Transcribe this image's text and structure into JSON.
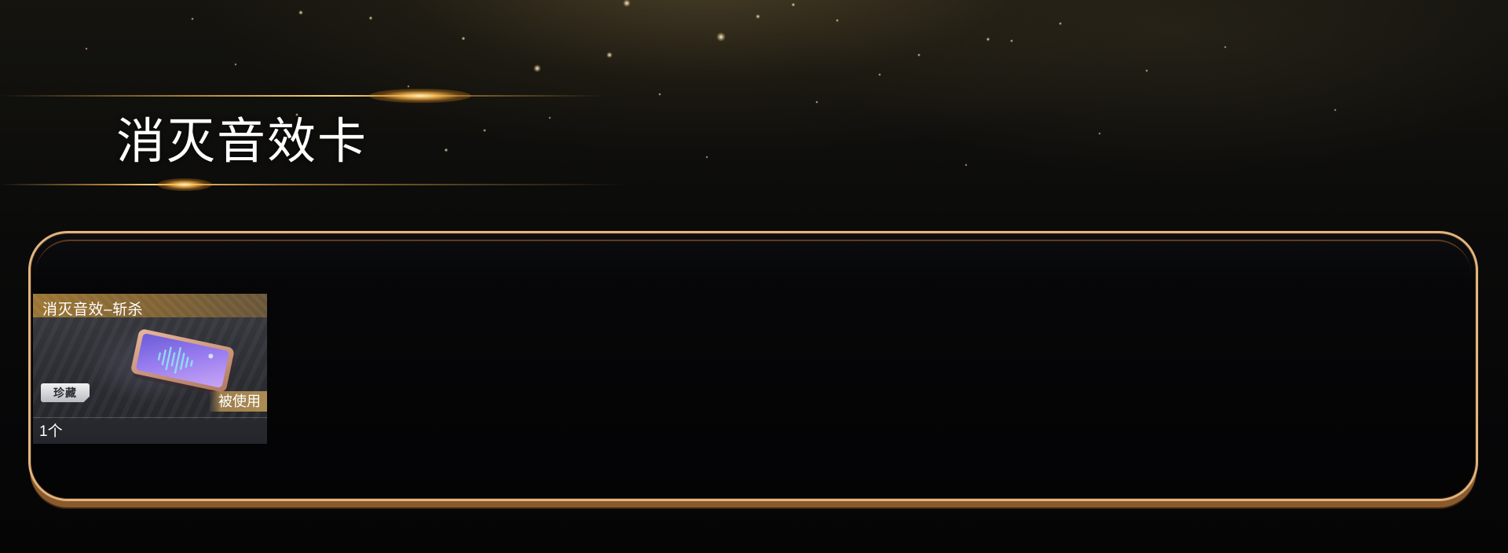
{
  "header": {
    "title": "消灭音效卡"
  },
  "items": [
    {
      "name": "消灭音效–斩杀",
      "rarity": "珍藏",
      "status": "被使用",
      "count": "1个"
    }
  ],
  "colors": {
    "accent_gold": "#e2b47e",
    "panel_shadow": "#8a5a2c",
    "card_name_bar": "#a07832",
    "card_bg": "#2c2e33"
  },
  "icons": {
    "item_icon": "sound-card-icon",
    "rarity_icon": "rarity-badge"
  }
}
